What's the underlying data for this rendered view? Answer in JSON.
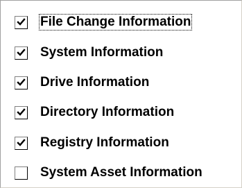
{
  "checkboxes": [
    {
      "label": "File Change Information",
      "checked": true,
      "focused": true
    },
    {
      "label": "System Information",
      "checked": true,
      "focused": false
    },
    {
      "label": "Drive Information",
      "checked": true,
      "focused": false
    },
    {
      "label": "Directory Information",
      "checked": true,
      "focused": false
    },
    {
      "label": "Registry Information",
      "checked": true,
      "focused": false
    },
    {
      "label": "System Asset Information",
      "checked": false,
      "focused": false
    }
  ],
  "icons": {
    "checkmark": "checkmark-icon"
  }
}
